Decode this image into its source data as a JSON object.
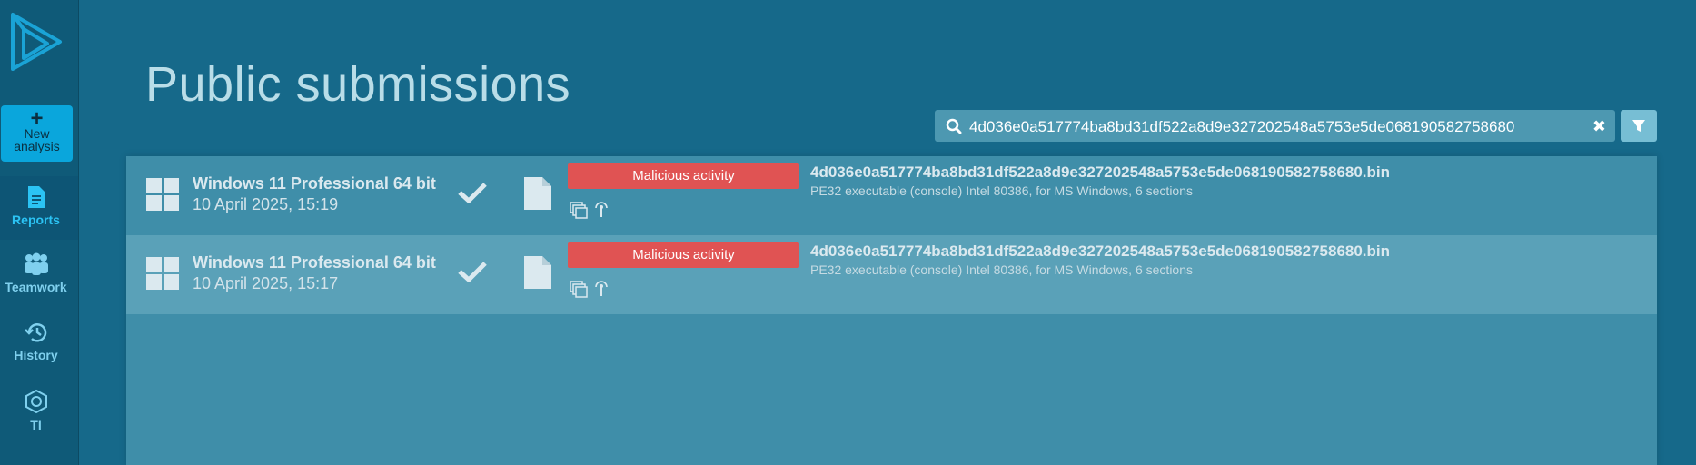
{
  "sidebar": {
    "new_analysis": {
      "plus": "+",
      "line1": "New",
      "line2": "analysis"
    },
    "items": [
      {
        "label": "Reports",
        "icon": "document-icon"
      },
      {
        "label": "Teamwork",
        "icon": "people-icon"
      },
      {
        "label": "History",
        "icon": "history-icon"
      },
      {
        "label": "TI",
        "icon": "hexagon-icon"
      }
    ]
  },
  "page": {
    "title": "Public submissions"
  },
  "search": {
    "value": "4d036e0a517774ba8bd31df522a8d9e327202548a5753e5de068190582758680",
    "clear_symbol": "✖"
  },
  "rows": [
    {
      "os": "Windows 11 Professional 64 bit",
      "date": "10 April 2025, 15:19",
      "verdict": "Malicious activity",
      "filename": "4d036e0a517774ba8bd31df522a8d9e327202548a5753e5de068190582758680.bin",
      "description": "PE32 executable (console) Intel 80386, for MS Windows, 6 sections"
    },
    {
      "os": "Windows 11 Professional 64 bit",
      "date": "10 April 2025, 15:17",
      "verdict": "Malicious activity",
      "filename": "4d036e0a517774ba8bd31df522a8d9e327202548a5753e5de068190582758680.bin",
      "description": "PE32 executable (console) Intel 80386, for MS Windows, 6 sections"
    }
  ],
  "colors": {
    "background": "#16698a",
    "sidebar": "#0f5a78",
    "accent": "#0aa6dc",
    "malicious": "#e05353"
  }
}
